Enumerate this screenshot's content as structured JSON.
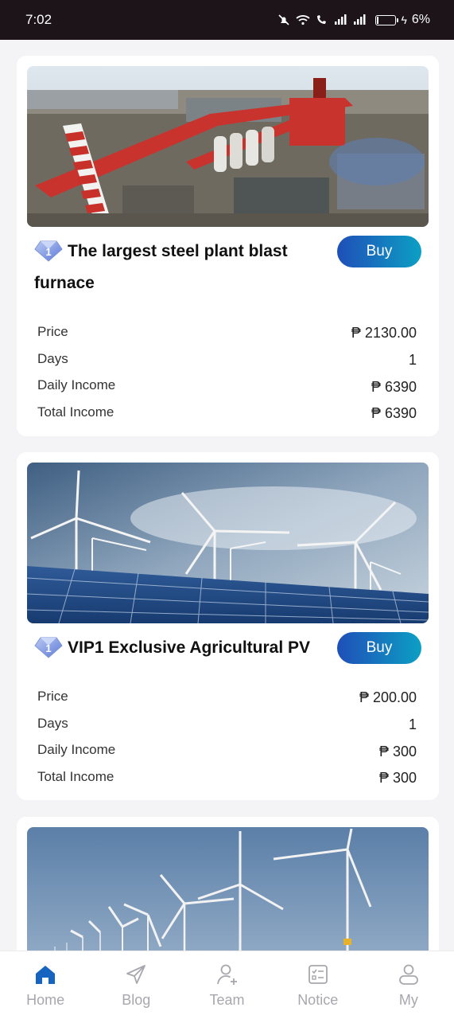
{
  "status_bar": {
    "time": "7:02",
    "battery": "6%"
  },
  "products": [
    {
      "title": "The largest steel plant blast furnace",
      "gem_level": "1",
      "buy_label": "Buy",
      "rows": [
        {
          "label": "Price",
          "value": "₱ 2130.00"
        },
        {
          "label": "Days",
          "value": "1"
        },
        {
          "label": "Daily Income",
          "value": "₱ 6390"
        },
        {
          "label": "Total Income",
          "value": "₱ 6390"
        }
      ]
    },
    {
      "title": "VIP1 Exclusive Agricultural PV",
      "gem_level": "1",
      "buy_label": "Buy",
      "rows": [
        {
          "label": "Price",
          "value": "₱ 200.00"
        },
        {
          "label": "Days",
          "value": "1"
        },
        {
          "label": "Daily Income",
          "value": "₱ 300"
        },
        {
          "label": "Total Income",
          "value": "₱ 300"
        }
      ]
    }
  ],
  "tabs": [
    {
      "label": "Home",
      "icon": "home-icon",
      "active": true
    },
    {
      "label": "Blog",
      "icon": "paper-plane-icon"
    },
    {
      "label": "Team",
      "icon": "user-add-icon"
    },
    {
      "label": "Notice",
      "icon": "checklist-icon"
    },
    {
      "label": "My",
      "icon": "person-icon"
    }
  ],
  "colors": {
    "accent": "#1565c0",
    "buy_start": "#1f4fb8",
    "buy_end": "#0c9fc4",
    "tab_inactive": "#a7a7ad"
  }
}
